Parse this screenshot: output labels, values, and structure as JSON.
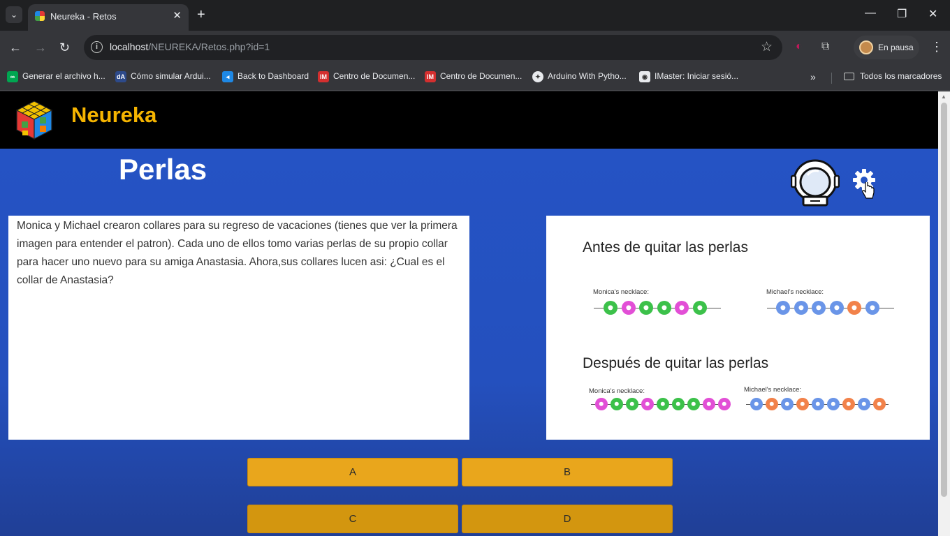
{
  "browser": {
    "tab_title": "Neureka - Retos",
    "url_host": "localhost",
    "url_path": "/NEUREKA/Retos.php?id=1",
    "profile_label": "En pausa",
    "bookmarks": [
      {
        "label": "Generar el archivo h...",
        "icon_color": "#00a651"
      },
      {
        "label": "Cómo simular Ardui...",
        "icon_color": "#2d4a8a"
      },
      {
        "label": "Back to Dashboard",
        "icon_color": "#1e88e5"
      },
      {
        "label": "Centro de Documen...",
        "icon_color": "#d32f2f"
      },
      {
        "label": "Centro de Documen...",
        "icon_color": "#d32f2f"
      },
      {
        "label": "Arduino With Pytho...",
        "icon_color": "#e8eaed"
      },
      {
        "label": "IMaster: Iniciar sesió...",
        "icon_color": "#e8eaed"
      }
    ],
    "all_bookmarks_label": "Todos los marcadores"
  },
  "site": {
    "brand": "Neureka",
    "brand_color": "#f5b400",
    "background_color": "#2553c4"
  },
  "challenge": {
    "title": "Perlas",
    "question": "Monica y Michael crearon collares para su regreso de vacaciones (tienes que ver la primera imagen para entender el patron). Cada uno de ellos tomo varias perlas de su propio collar para hacer uno nuevo para su amiga Anastasia. Ahora,sus collares lucen asi: ¿Cual es el collar de Anastasia?",
    "image": {
      "before_heading": "Antes de quitar las perlas",
      "after_heading": "Después de quitar las perlas",
      "monica_label": "Monica's necklace:",
      "michael_label": "Michael's necklace:",
      "before_monica": [
        "green",
        "pink",
        "green",
        "green",
        "pink",
        "green"
      ],
      "before_michael": [
        "blue",
        "blue",
        "blue",
        "blue",
        "orange",
        "blue"
      ],
      "after_monica": [
        "pink",
        "green",
        "green",
        "pink",
        "green",
        "green",
        "green",
        "pink",
        "pink"
      ],
      "after_michael": [
        "blue",
        "orange",
        "blue",
        "orange",
        "blue",
        "blue",
        "orange",
        "blue",
        "orange"
      ]
    },
    "answers": [
      "A",
      "B",
      "C",
      "D"
    ]
  },
  "colors": {
    "green": "#3cc14a",
    "pink": "#e24fd6",
    "blue": "#6a95e8",
    "orange": "#f2824a"
  }
}
